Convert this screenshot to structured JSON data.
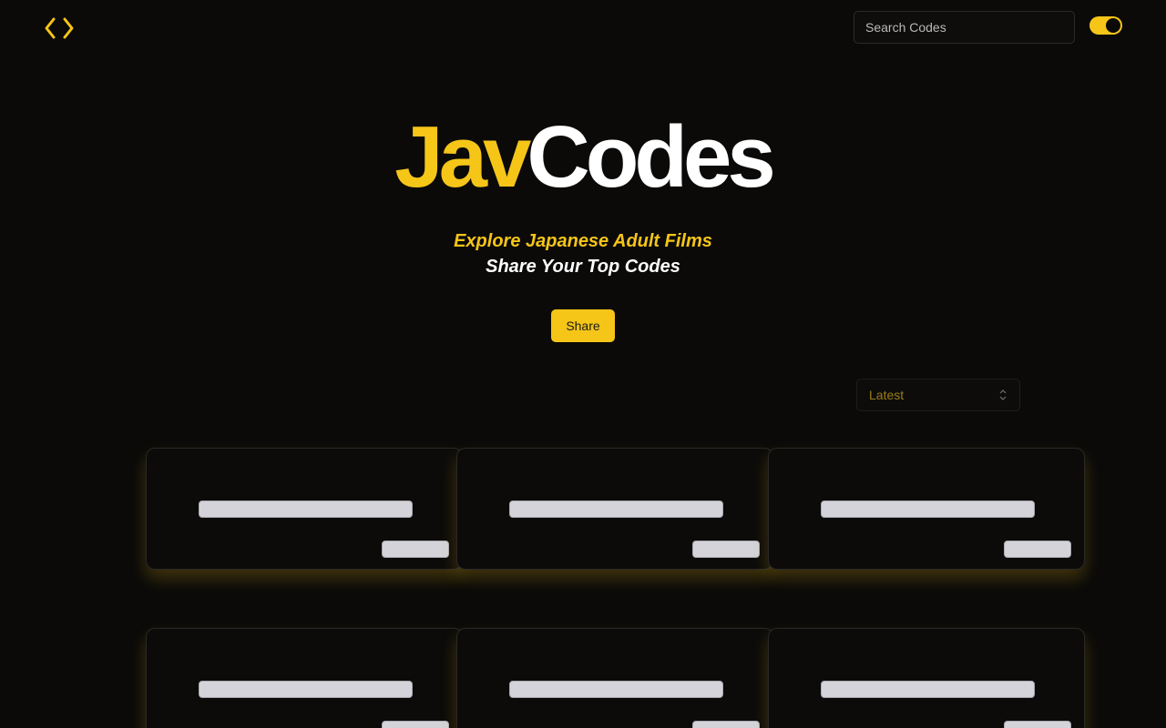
{
  "header": {
    "logo_icon": "code-brackets-icon",
    "search": {
      "placeholder": "Search Codes",
      "value": ""
    },
    "theme_toggle": {
      "state": "on",
      "color": "#f5c518"
    }
  },
  "hero": {
    "title_part1": "Jav",
    "title_part2": "Codes",
    "tagline1": "Explore Japanese Adult Films",
    "tagline2": "Share Your Top Codes",
    "share_label": "Share"
  },
  "sort": {
    "selected": "Latest",
    "icon": "chevron-up-down-icon"
  },
  "cards": [
    {
      "state": "loading"
    },
    {
      "state": "loading"
    },
    {
      "state": "loading"
    },
    {
      "state": "loading"
    },
    {
      "state": "loading"
    },
    {
      "state": "loading"
    }
  ],
  "colors": {
    "accent": "#f5c518",
    "background": "#0b0a09",
    "text": "#ffffff",
    "skeleton": "#d3d3d9"
  }
}
